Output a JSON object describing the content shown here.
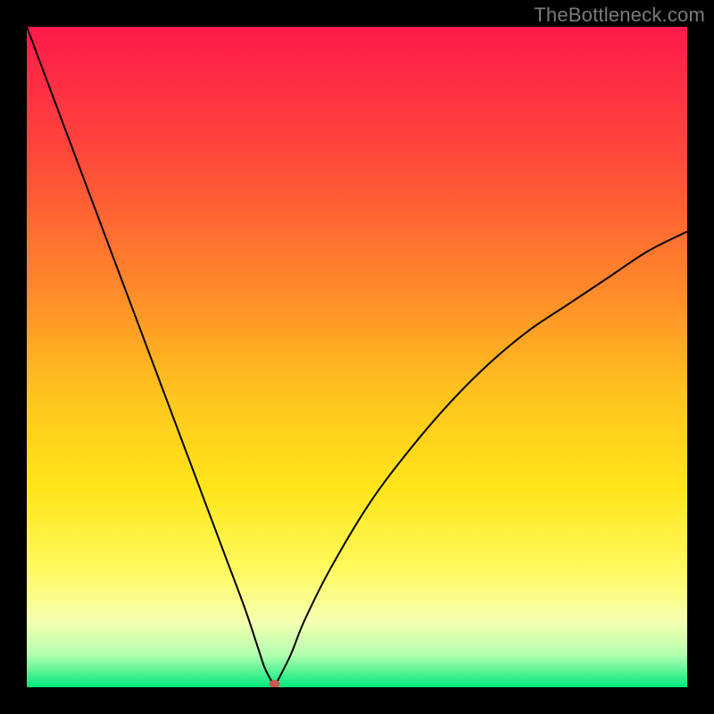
{
  "watermark": "TheBottleneck.com",
  "chart_data": {
    "type": "line",
    "title": "",
    "xlabel": "",
    "ylabel": "",
    "xlim": [
      0,
      100
    ],
    "ylim": [
      0,
      100
    ],
    "grid": false,
    "legend": false,
    "background_gradient": {
      "stops": [
        {
          "offset": 0.0,
          "color": "#ff1a4b"
        },
        {
          "offset": 0.2,
          "color": "#ff4a3a"
        },
        {
          "offset": 0.4,
          "color": "#ff8a2a"
        },
        {
          "offset": 0.55,
          "color": "#ffc21e"
        },
        {
          "offset": 0.7,
          "color": "#ffe61a"
        },
        {
          "offset": 0.82,
          "color": "#fff95e"
        },
        {
          "offset": 0.9,
          "color": "#f6ffb0"
        },
        {
          "offset": 0.95,
          "color": "#b6ffb0"
        },
        {
          "offset": 1.0,
          "color": "#00e87a"
        }
      ]
    },
    "series": [
      {
        "name": "bottleneck-curve",
        "color": "#000000",
        "width": 2,
        "x": [
          0,
          3,
          6,
          9,
          12,
          15,
          18,
          21,
          24,
          27,
          30,
          33,
          35,
          36,
          37,
          37.5,
          38,
          40,
          42,
          46,
          52,
          58,
          64,
          70,
          76,
          82,
          88,
          94,
          100
        ],
        "y": [
          100,
          92,
          84,
          76,
          68,
          60,
          52,
          44,
          36,
          28,
          20,
          12,
          6,
          3,
          1,
          0,
          1,
          5,
          10,
          18,
          28,
          36,
          43,
          49,
          54,
          58,
          62,
          66,
          69
        ]
      }
    ],
    "marker": {
      "name": "bottleneck-point",
      "x": 37.5,
      "y": 0.5,
      "rx": 6,
      "ry": 4.5,
      "fill": "#c65a52"
    }
  }
}
